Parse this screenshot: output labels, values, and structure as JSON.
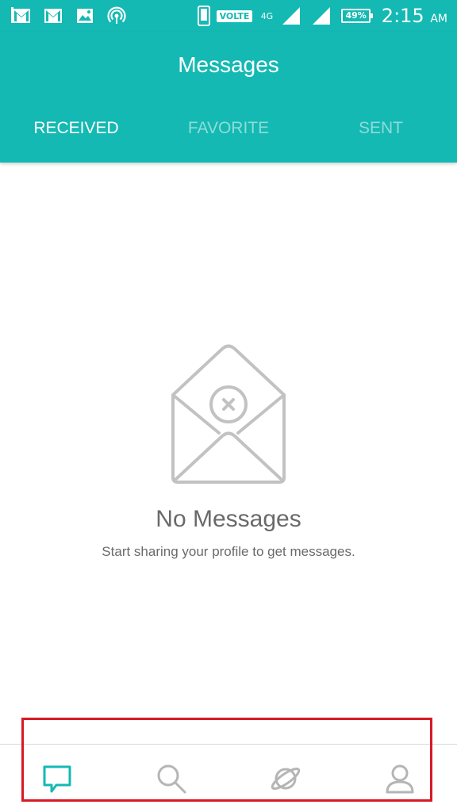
{
  "status_bar": {
    "volte": "VOLTE",
    "network": "4G",
    "sim1": "1",
    "sim2": "2",
    "battery": "49%",
    "time": "2:15",
    "ampm": "AM"
  },
  "header": {
    "title": "Messages",
    "tabs": [
      {
        "label": "RECEIVED",
        "active": true
      },
      {
        "label": "FAVORITE",
        "active": false
      },
      {
        "label": "SENT",
        "active": false
      }
    ]
  },
  "empty_state": {
    "icon": "envelope-x-icon",
    "title": "No Messages",
    "subtitle": "Start sharing your profile to get messages."
  },
  "bottom_nav": {
    "items": [
      {
        "icon": "chat-bubble-icon",
        "active": true
      },
      {
        "icon": "search-icon",
        "active": false
      },
      {
        "icon": "planet-icon",
        "active": false
      },
      {
        "icon": "profile-icon",
        "active": false
      }
    ]
  },
  "colors": {
    "primary": "#14b9b3",
    "inactive_tab": "#8fdcd8",
    "text_gray": "#6a6a6a",
    "icon_gray": "#b5b5b5",
    "highlight": "#d61a25"
  }
}
